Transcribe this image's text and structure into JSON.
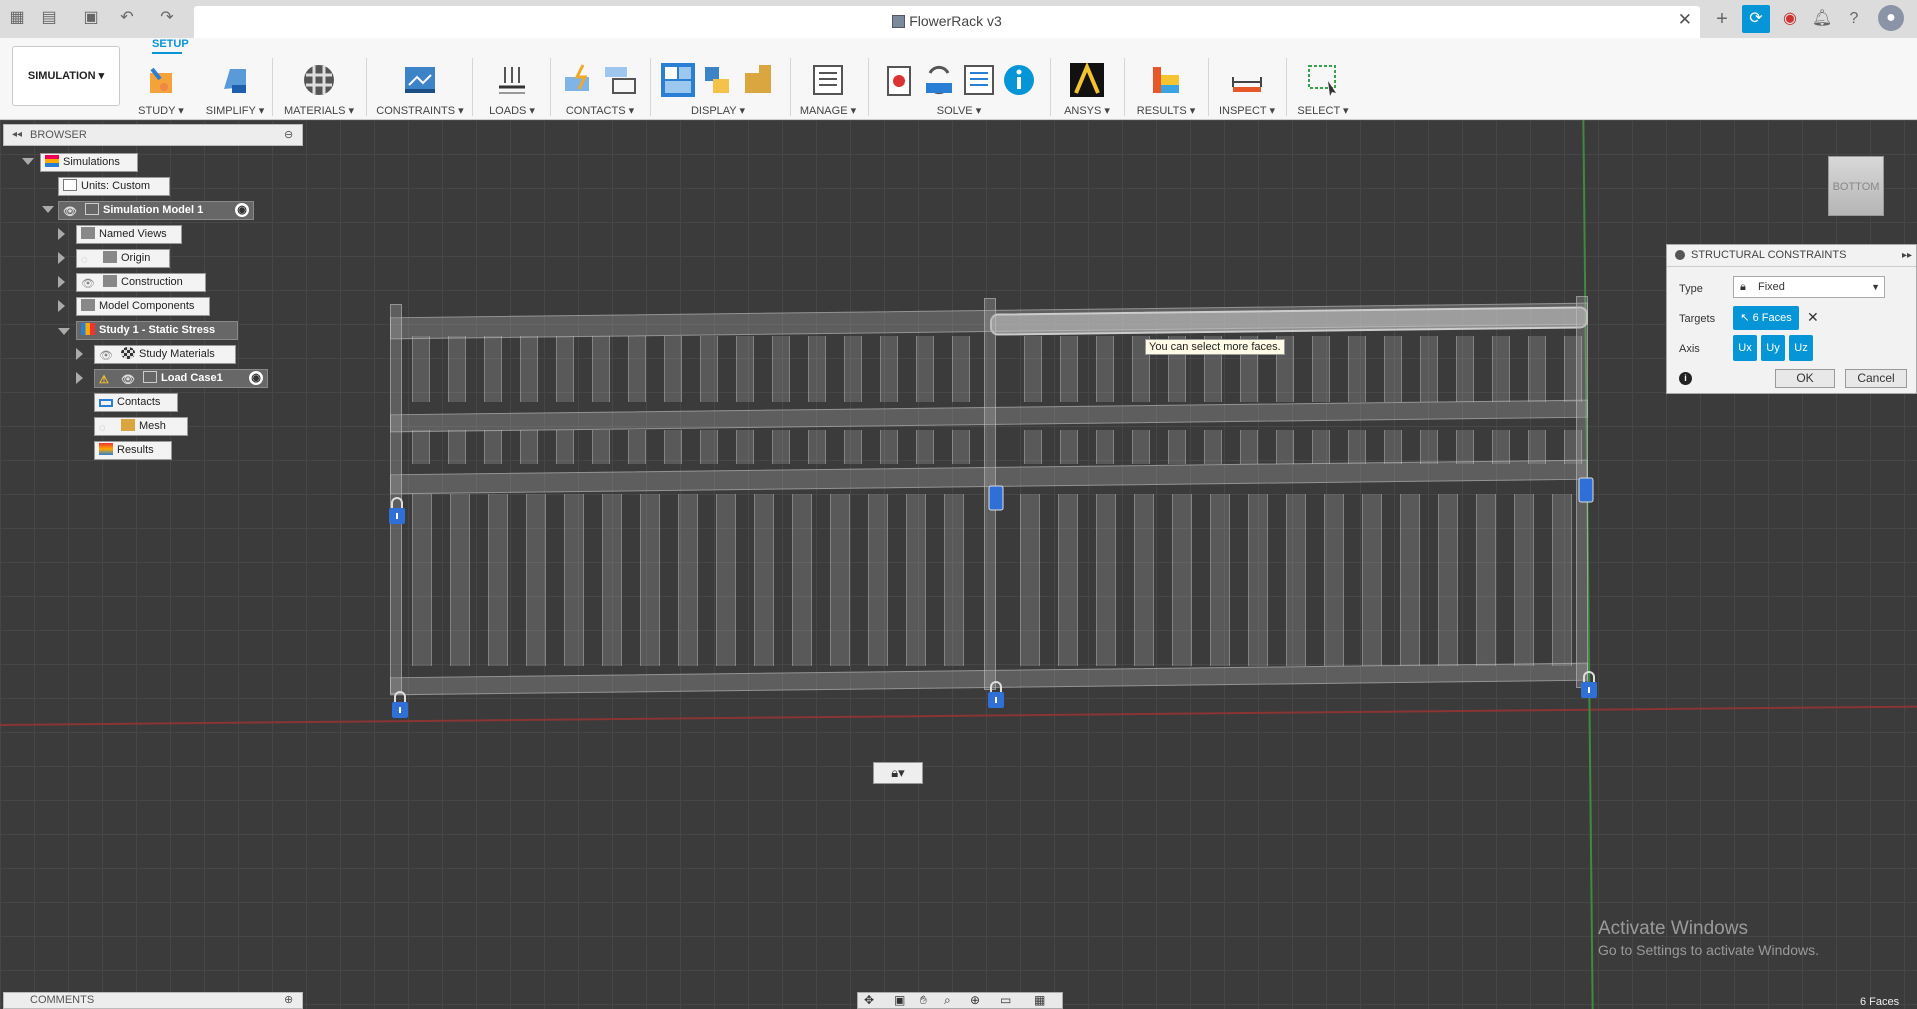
{
  "window": {
    "title": "FlowerRack v3"
  },
  "ribbon": {
    "workspace": "SIMULATION ▾",
    "active_tab": "SETUP",
    "groups": [
      {
        "label": "STUDY ▾"
      },
      {
        "label": "SIMPLIFY ▾"
      },
      {
        "label": "MATERIALS ▾"
      },
      {
        "label": "CONSTRAINTS ▾"
      },
      {
        "label": "LOADS ▾"
      },
      {
        "label": "CONTACTS ▾"
      },
      {
        "label": "DISPLAY ▾"
      },
      {
        "label": "MANAGE ▾"
      },
      {
        "label": "SOLVE ▾"
      },
      {
        "label": "ANSYS ▾"
      },
      {
        "label": "RESULTS ▾"
      },
      {
        "label": "INSPECT ▾"
      },
      {
        "label": "SELECT ▾"
      }
    ]
  },
  "browser": {
    "title": "BROWSER",
    "nodes": {
      "simulations": "Simulations",
      "units": "Units: Custom",
      "sim_model": "Simulation Model 1",
      "named_views": "Named Views",
      "origin": "Origin",
      "construction": "Construction",
      "model_components": "Model Components",
      "study": "Study 1 - Static Stress",
      "study_materials": "Study Materials",
      "load_case": "Load Case1",
      "contacts": "Contacts",
      "mesh": "Mesh",
      "results": "Results"
    }
  },
  "viewcube": {
    "face": "BOTTOM"
  },
  "tooltip": "You can select more faces.",
  "dialog": {
    "title": "STRUCTURAL CONSTRAINTS",
    "type_label": "Type",
    "type_value": "Fixed",
    "targets_label": "Targets",
    "targets_value": "6 Faces",
    "axis_label": "Axis",
    "axes": [
      "Ux",
      "Uy",
      "Uz"
    ],
    "ok": "OK",
    "cancel": "Cancel"
  },
  "watermark": {
    "title": "Activate Windows",
    "subtitle": "Go to Settings to activate Windows."
  },
  "comments": {
    "title": "COMMENTS"
  },
  "status": {
    "selection": "6 Faces"
  },
  "colors": {
    "accent": "#0696d7",
    "constraint": "#2f6fd6"
  }
}
